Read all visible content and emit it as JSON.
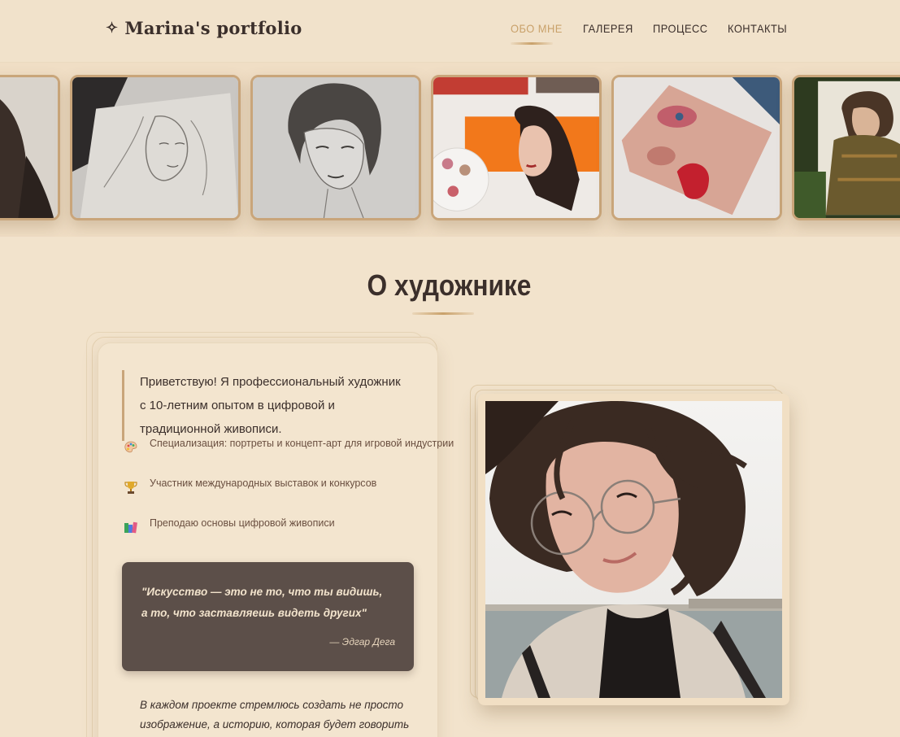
{
  "header": {
    "logo_icon": "sparkle-icon",
    "logo_text": "Marina's portfolio",
    "nav": [
      {
        "label": "ОБО МНЕ",
        "active": true
      },
      {
        "label": "ГАЛЕРЕЯ",
        "active": false
      },
      {
        "label": "ПРОЦЕСС",
        "active": false
      },
      {
        "label": "КОНТАКТЫ",
        "active": false
      }
    ]
  },
  "gallery": {
    "items": [
      {
        "name": "dark-hair-portrait"
      },
      {
        "name": "elf-pencil-sketch"
      },
      {
        "name": "girl-pencil-sketch"
      },
      {
        "name": "watercolor-portrait-orange"
      },
      {
        "name": "red-lips-watercolor"
      },
      {
        "name": "elf-warrior-painting"
      }
    ]
  },
  "about": {
    "title": "О художнике",
    "intro": "Приветствую! Я профессиональный художник с 10-летним опытом в цифровой и традиционной живописи.",
    "features": [
      {
        "icon": "palette-icon",
        "text": "Специализация: портреты и концепт-арт для игровой индустрии"
      },
      {
        "icon": "trophy-icon",
        "text": "Участник международных выставок и конкурсов"
      },
      {
        "icon": "books-icon",
        "text": "Преподаю основы цифровой живописи"
      }
    ],
    "quote": "\"Искусство — это не то, что ты видишь, а то, что заставляешь видеть других\"",
    "quote_author": "— Эдгар Дега",
    "closing": "В каждом проекте стремлюсь создать не просто изображение, а историю, которая будет говорить сама за себя."
  },
  "colors": {
    "background": "#f2e3cc",
    "accent": "#c9a16a",
    "text": "#3b2f2b",
    "quote_bg": "#5c4f49"
  }
}
